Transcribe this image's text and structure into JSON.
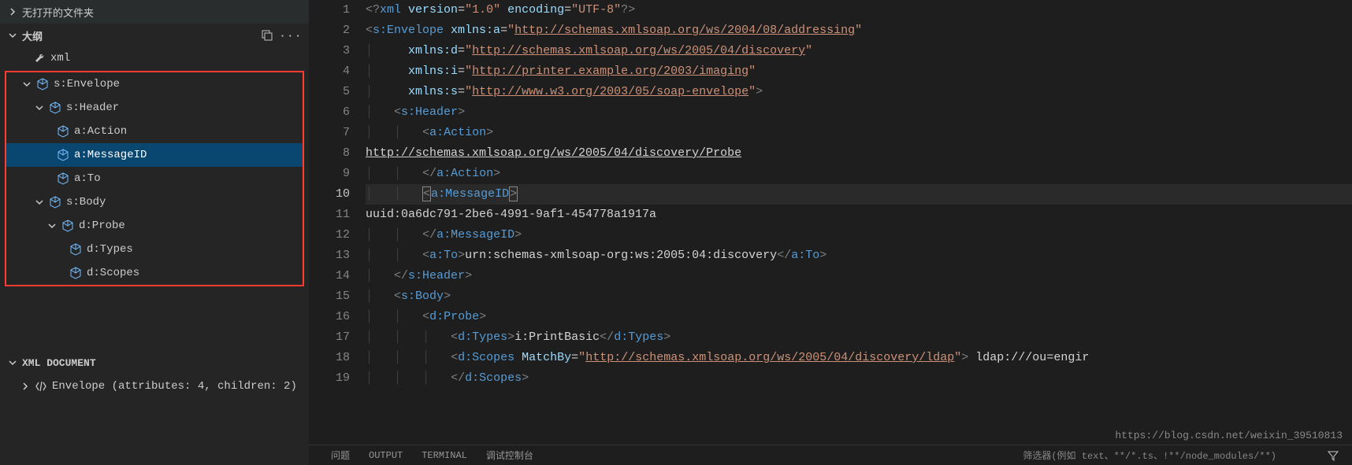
{
  "sidebar": {
    "no_open_folder": "无打开的文件夹",
    "outline_title": "大纲",
    "wrench_label": "xml",
    "tree": {
      "envelope": "s:Envelope",
      "header": "s:Header",
      "action": "a:Action",
      "messageid": "a:MessageID",
      "to": "a:To",
      "body": "s:Body",
      "probe": "d:Probe",
      "types": "d:Types",
      "scopes": "d:Scopes"
    },
    "xml_doc_title": "XML DOCUMENT",
    "xml_doc_item": "Envelope  (attributes: 4, children: 2)"
  },
  "code": {
    "lines": [
      {
        "n": 1,
        "xml_decl": {
          "version": "1.0",
          "encoding": "UTF-8"
        }
      },
      {
        "n": 2,
        "open": "s:Envelope",
        "attr": "xmlns:a",
        "url": "http://schemas.xmlsoap.org/ws/2004/08/addressing"
      },
      {
        "n": 3,
        "attr": "xmlns:d",
        "url": "http://schemas.xmlsoap.org/ws/2005/04/discovery"
      },
      {
        "n": 4,
        "attr": "xmlns:i",
        "url": "http://printer.example.org/2003/imaging"
      },
      {
        "n": 5,
        "attr": "xmlns:s",
        "url": "http://www.w3.org/2003/05/soap-envelope",
        "close": ">"
      },
      {
        "n": 6,
        "open": "s:Header"
      },
      {
        "n": 7,
        "open": "a:Action"
      },
      {
        "n": 8,
        "text": "http://schemas.xmlsoap.org/ws/2005/04/discovery/Probe"
      },
      {
        "n": 9,
        "end": "a:Action"
      },
      {
        "n": 10,
        "open_cursor": "a:MessageID",
        "current": true
      },
      {
        "n": 11,
        "text": "uuid:0a6dc791-2be6-4991-9af1-454778a1917a"
      },
      {
        "n": 12,
        "end": "a:MessageID"
      },
      {
        "n": 13,
        "open": "a:To",
        "inline_text": "urn:schemas-xmlsoap-org:ws:2005:04:discovery",
        "end_inline": "a:To"
      },
      {
        "n": 14,
        "end": "s:Header"
      },
      {
        "n": 15,
        "open": "s:Body"
      },
      {
        "n": 16,
        "open": "d:Probe"
      },
      {
        "n": 17,
        "open": "d:Types",
        "inline_text": "i:PrintBasic",
        "end_inline": "d:Types"
      },
      {
        "n": 18,
        "open": "d:Scopes",
        "attr": "MatchBy",
        "url": "http://schemas.xmlsoap.org/ws/2005/04/discovery/ldap",
        "close": ">",
        "trail": " ldap:///ou=engir"
      },
      {
        "n": 19,
        "end": "d:Scopes"
      }
    ]
  },
  "panel": {
    "tabs": [
      "问题",
      "OUTPUT",
      "TERMINAL",
      "调试控制台"
    ],
    "right": "筛选器(例如 text、**/*.ts、!**/node_modules/**)"
  },
  "watermark": "https://blog.csdn.net/weixin_39510813"
}
